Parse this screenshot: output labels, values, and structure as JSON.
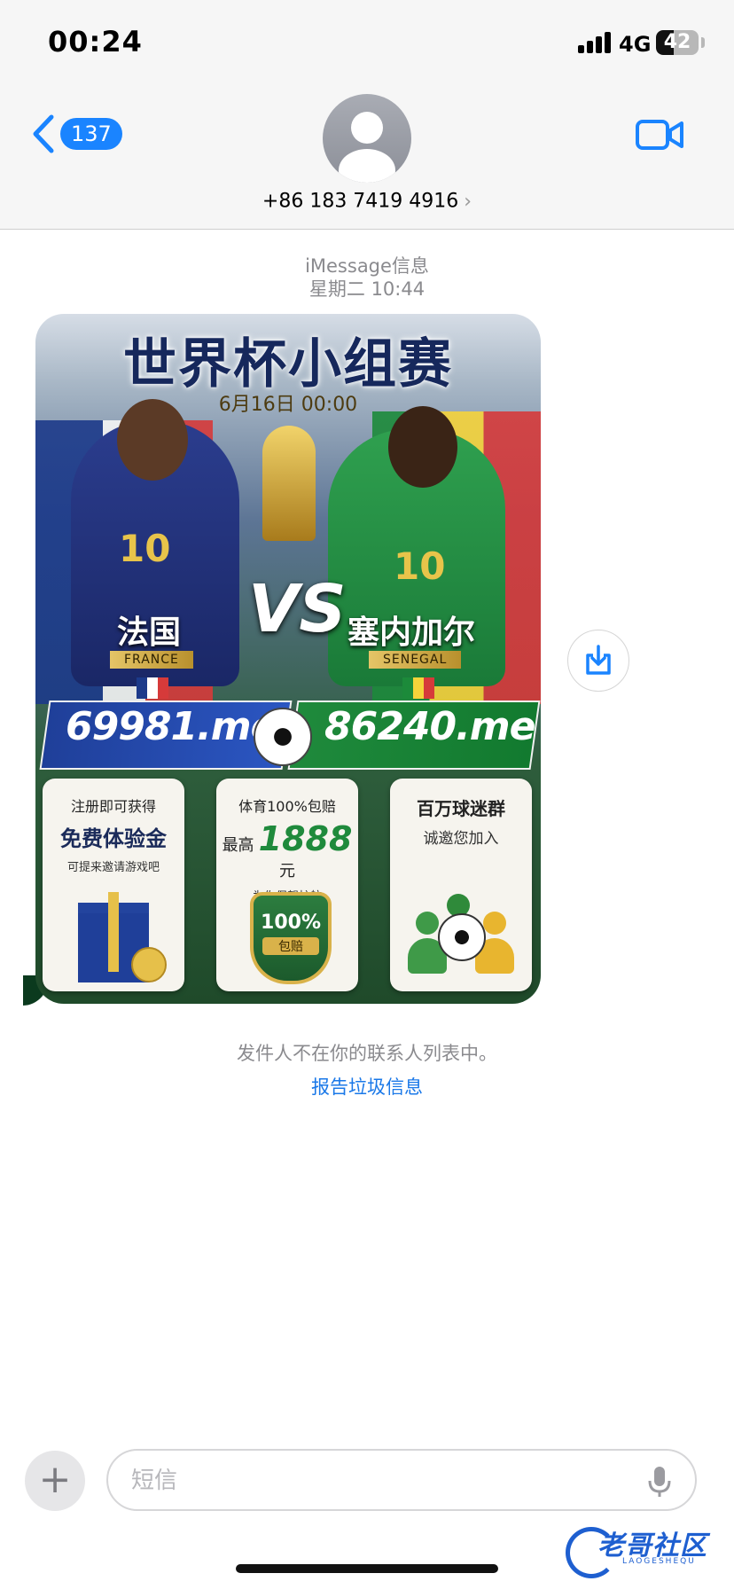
{
  "status_bar": {
    "time": "00:24",
    "network": "4G",
    "battery_percent": "42",
    "battery_level": 0.42,
    "signal_bars": 4
  },
  "header": {
    "back_count": "137",
    "contact_number": "+86 183 7419 4916",
    "contact_chevron": "›",
    "accent_color": "#1a84ff"
  },
  "conversation": {
    "service_label": "iMessage信息",
    "timestamp": "星期二 10:44",
    "notice": "发件人不在你的联系人列表中。",
    "report_link": "报告垃圾信息"
  },
  "poster": {
    "title": "世界杯小组赛",
    "date": "6月16日 00:00",
    "vs": "VS",
    "team_left": {
      "name_cn": "法国",
      "name_en": "FRANCE",
      "jersey": "10"
    },
    "team_right": {
      "name_cn": "塞内加尔",
      "name_en": "SENEGAL",
      "jersey": "10"
    },
    "domain_left": "69981.me",
    "domain_right": "86240.me",
    "card1": {
      "line1": "注册即可获得",
      "line2": "免费体验金",
      "line3": "可提来邀请游戏吧"
    },
    "card2": {
      "line1": "体育100%包赔",
      "prefix": "最高",
      "amount": "1888",
      "unit": "元",
      "line3": "为你保驾护航",
      "shield_pct": "100%",
      "shield_text": "包赔"
    },
    "card3": {
      "line1": "百万球迷群",
      "line2": "诚邀您加入"
    }
  },
  "input_bar": {
    "placeholder": "短信"
  },
  "icons": {
    "back": "chevron-left-icon",
    "video": "video-camera-icon",
    "save": "download-icon",
    "plus": "plus-icon",
    "mic": "microphone-icon"
  },
  "watermark": {
    "text": "老哥社区",
    "sub": "LAOGESHEQU"
  }
}
